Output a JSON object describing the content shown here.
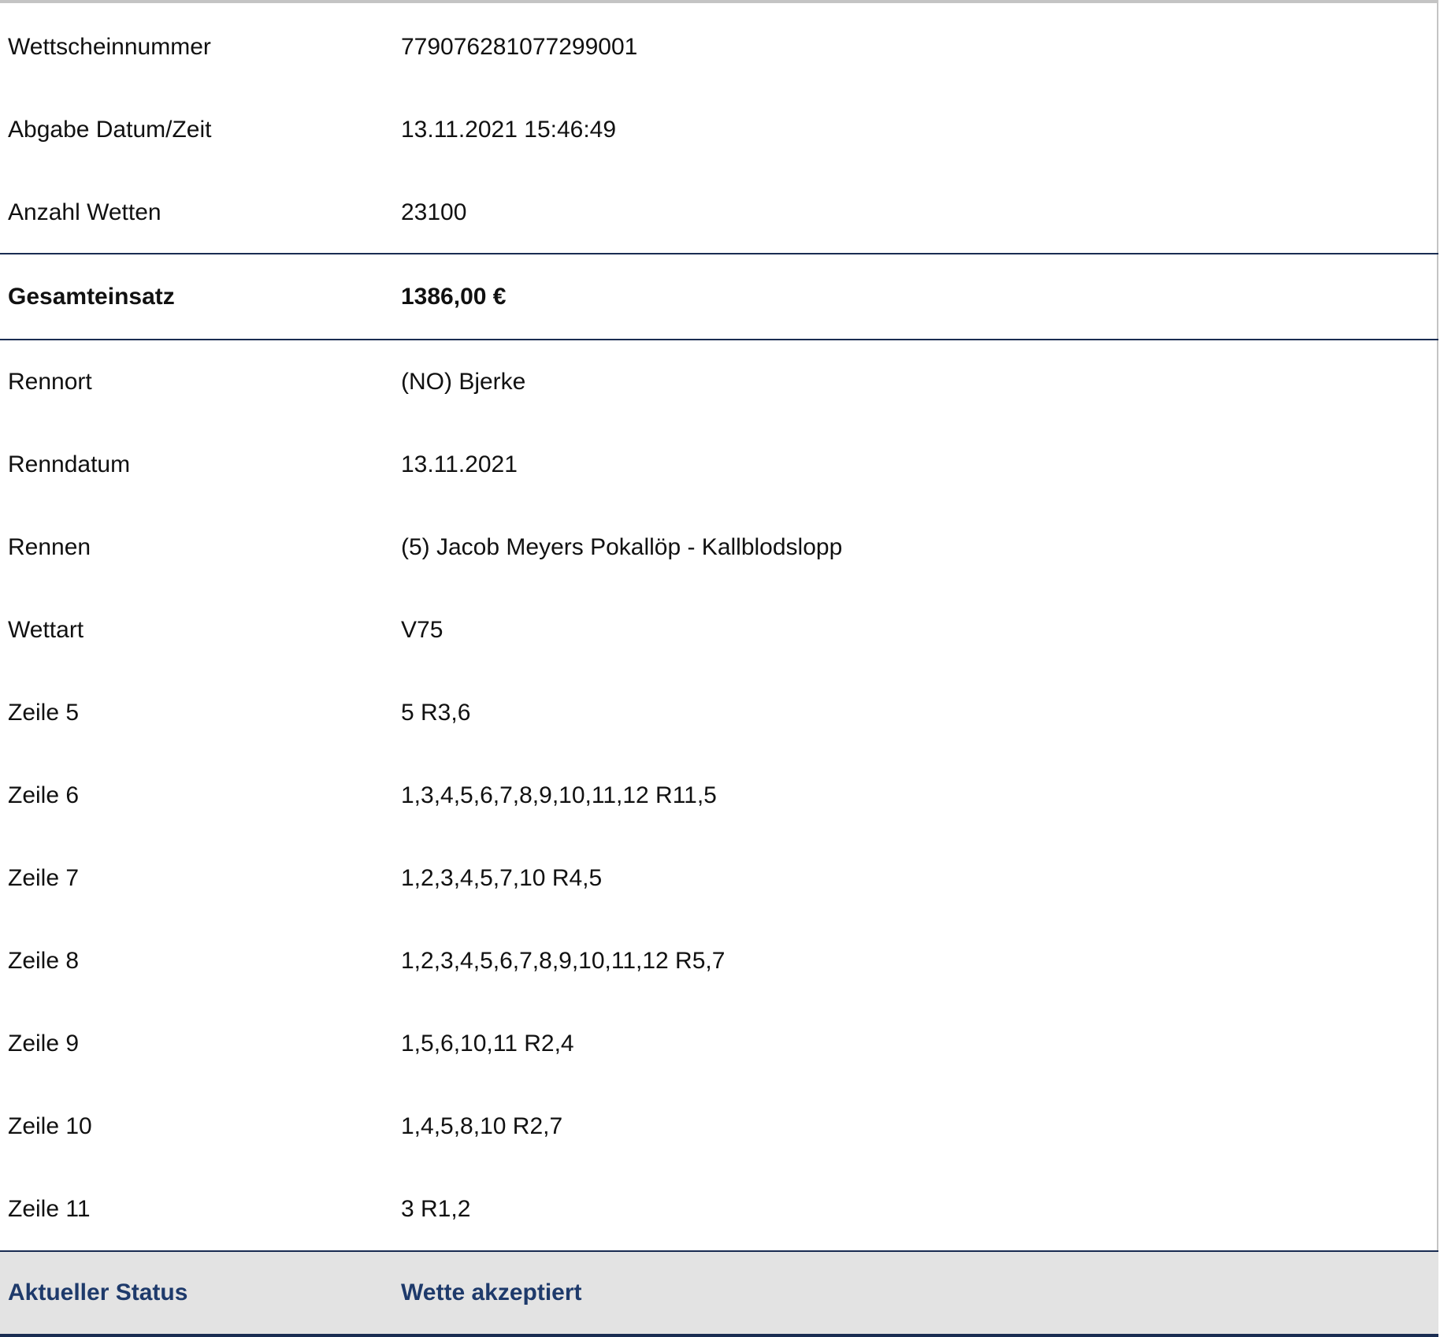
{
  "ticket": {
    "rows": [
      {
        "label": "Wettscheinnummer",
        "value": "779076281077299001"
      },
      {
        "label": "Abgabe Datum/Zeit",
        "value": "13.11.2021 15:46:49"
      },
      {
        "label": "Anzahl Wetten",
        "value": "23100"
      },
      {
        "label": "Gesamteinsatz",
        "value": "1386,00 €"
      },
      {
        "label": "Rennort",
        "value": "(NO) Bjerke"
      },
      {
        "label": "Renndatum",
        "value": "13.11.2021"
      },
      {
        "label": "Rennen",
        "value": "(5) Jacob Meyers Pokallöp - Kallblodslopp"
      },
      {
        "label": "Wettart",
        "value": "V75"
      },
      {
        "label": "Zeile 5",
        "value": "5 R3,6"
      },
      {
        "label": "Zeile 6",
        "value": "1,3,4,5,6,7,8,9,10,11,12 R11,5"
      },
      {
        "label": "Zeile 7",
        "value": "1,2,3,4,5,7,10 R4,5"
      },
      {
        "label": "Zeile 8",
        "value": "1,2,3,4,5,6,7,8,9,10,11,12 R5,7"
      },
      {
        "label": "Zeile 9",
        "value": "1,5,6,10,11 R2,4"
      },
      {
        "label": "Zeile 10",
        "value": "1,4,5,8,10 R2,7"
      },
      {
        "label": "Zeile 11",
        "value": "3 R1,2"
      },
      {
        "label": "Aktueller Status",
        "value": "Wette akzeptiert"
      }
    ]
  },
  "colors": {
    "border": "#1a2d52",
    "status_text": "#1e3a6b",
    "status_background": "#e3e3e3",
    "outer_border": "#c4c4c4"
  }
}
